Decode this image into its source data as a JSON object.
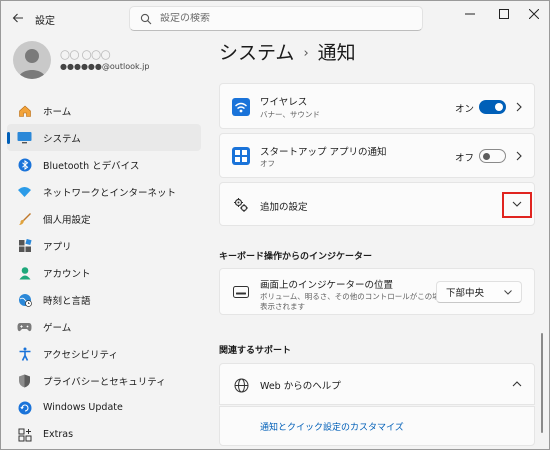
{
  "window": {
    "app_title": "設定",
    "search": {
      "placeholder": "設定の検索",
      "value": ""
    }
  },
  "profile": {
    "name_masked": "〇〇 〇〇〇",
    "email": "●●●●●●@outlook.jp"
  },
  "sidebar": {
    "items": [
      {
        "label": "ホーム",
        "icon": "home-icon",
        "active": false
      },
      {
        "label": "システム",
        "icon": "system-icon",
        "active": true
      },
      {
        "label": "Bluetooth とデバイス",
        "icon": "bluetooth-icon",
        "active": false
      },
      {
        "label": "ネットワークとインターネット",
        "icon": "network-icon",
        "active": false
      },
      {
        "label": "個人用設定",
        "icon": "brush-icon",
        "active": false
      },
      {
        "label": "アプリ",
        "icon": "apps-icon",
        "active": false
      },
      {
        "label": "アカウント",
        "icon": "account-icon",
        "active": false
      },
      {
        "label": "時刻と言語",
        "icon": "time-language-icon",
        "active": false
      },
      {
        "label": "ゲーム",
        "icon": "gaming-icon",
        "active": false
      },
      {
        "label": "アクセシビリティ",
        "icon": "accessibility-icon",
        "active": false
      },
      {
        "label": "プライバシーとセキュリティ",
        "icon": "shield-icon",
        "active": false
      },
      {
        "label": "Windows Update",
        "icon": "windows-update-icon",
        "active": false
      },
      {
        "label": "Extras",
        "icon": "extras-icon",
        "active": false
      }
    ]
  },
  "breadcrumb": {
    "parent": "システム",
    "separator": "›",
    "current": "通知"
  },
  "notifications": {
    "wireless": {
      "title": "ワイヤレス",
      "subtitle": "バナー、サウンド",
      "state": "オン",
      "on": true
    },
    "startup_apps": {
      "title": "スタートアップ アプリの通知",
      "subtitle": "オフ",
      "state": "オフ",
      "on": false
    },
    "additional": {
      "title": "追加の設定"
    }
  },
  "indicator_section": {
    "heading": "キーボード操作からのインジケーター",
    "title": "画面上のインジケーターの位置",
    "description_line1": "ボリューム、明るさ、その他のコントロールがこの場所に",
    "description_line2": "表示されます",
    "dropdown_value": "下部中央"
  },
  "support_section": {
    "heading": "関連するサポート",
    "help_title": "Web からのヘルプ",
    "link": "通知とクイック設定のカスタマイズ"
  },
  "colors": {
    "accent": "#005fb8",
    "highlight": "#e0241f"
  }
}
